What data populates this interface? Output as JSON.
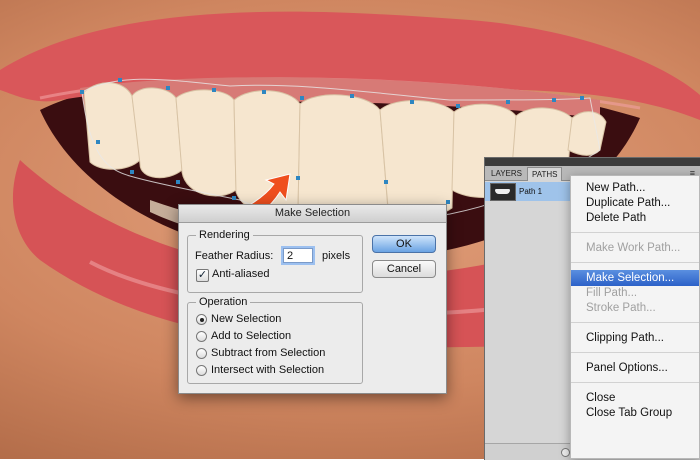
{
  "dialog": {
    "title": "Make Selection",
    "rendering": {
      "group_label": "Rendering",
      "feather_label": "Feather Radius:",
      "feather_value": "2",
      "feather_unit": "pixels",
      "antialiased_label": "Anti-aliased",
      "antialiased_checked": true
    },
    "operation": {
      "group_label": "Operation",
      "options": [
        {
          "label": "New Selection",
          "selected": true
        },
        {
          "label": "Add to Selection",
          "selected": false
        },
        {
          "label": "Subtract from Selection",
          "selected": false
        },
        {
          "label": "Intersect with Selection",
          "selected": false
        }
      ]
    },
    "ok_label": "OK",
    "cancel_label": "Cancel"
  },
  "panel": {
    "tabs": [
      {
        "label": "LAYERS",
        "active": false
      },
      {
        "label": "PATHS",
        "active": true
      }
    ],
    "path_name": "Path 1",
    "menu_icon": "≡"
  },
  "menu": {
    "items": [
      {
        "label": "New Path...",
        "disabled": false,
        "highlighted": false
      },
      {
        "label": "Duplicate Path...",
        "disabled": false,
        "highlighted": false
      },
      {
        "label": "Delete Path",
        "disabled": false,
        "highlighted": false
      },
      {
        "label": "Make Work Path...",
        "disabled": true,
        "highlighted": false
      },
      {
        "label": "Make Selection...",
        "disabled": false,
        "highlighted": true
      },
      {
        "label": "Fill Path...",
        "disabled": true,
        "highlighted": false
      },
      {
        "label": "Stroke Path...",
        "disabled": true,
        "highlighted": false
      },
      {
        "label": "Clipping Path...",
        "disabled": false,
        "highlighted": false
      },
      {
        "label": "Panel Options...",
        "disabled": false,
        "highlighted": false
      },
      {
        "label": "Close",
        "disabled": false,
        "highlighted": false
      },
      {
        "label": "Close Tab Group",
        "disabled": false,
        "highlighted": false
      }
    ]
  },
  "colors": {
    "skin": "#cf8660",
    "lips": "#d9575a",
    "teeth": "#f6e6cf",
    "arrow": "#ef4f1e",
    "menu_highlight": "#2c61c8"
  },
  "icons": [
    "path-thumbnail-icon",
    "panel-menu-icon",
    "fill-path-icon",
    "stroke-path-icon",
    "load-selection-icon",
    "work-path-icon",
    "new-path-icon",
    "delete-path-icon",
    "annotation-arrow-icon"
  ]
}
